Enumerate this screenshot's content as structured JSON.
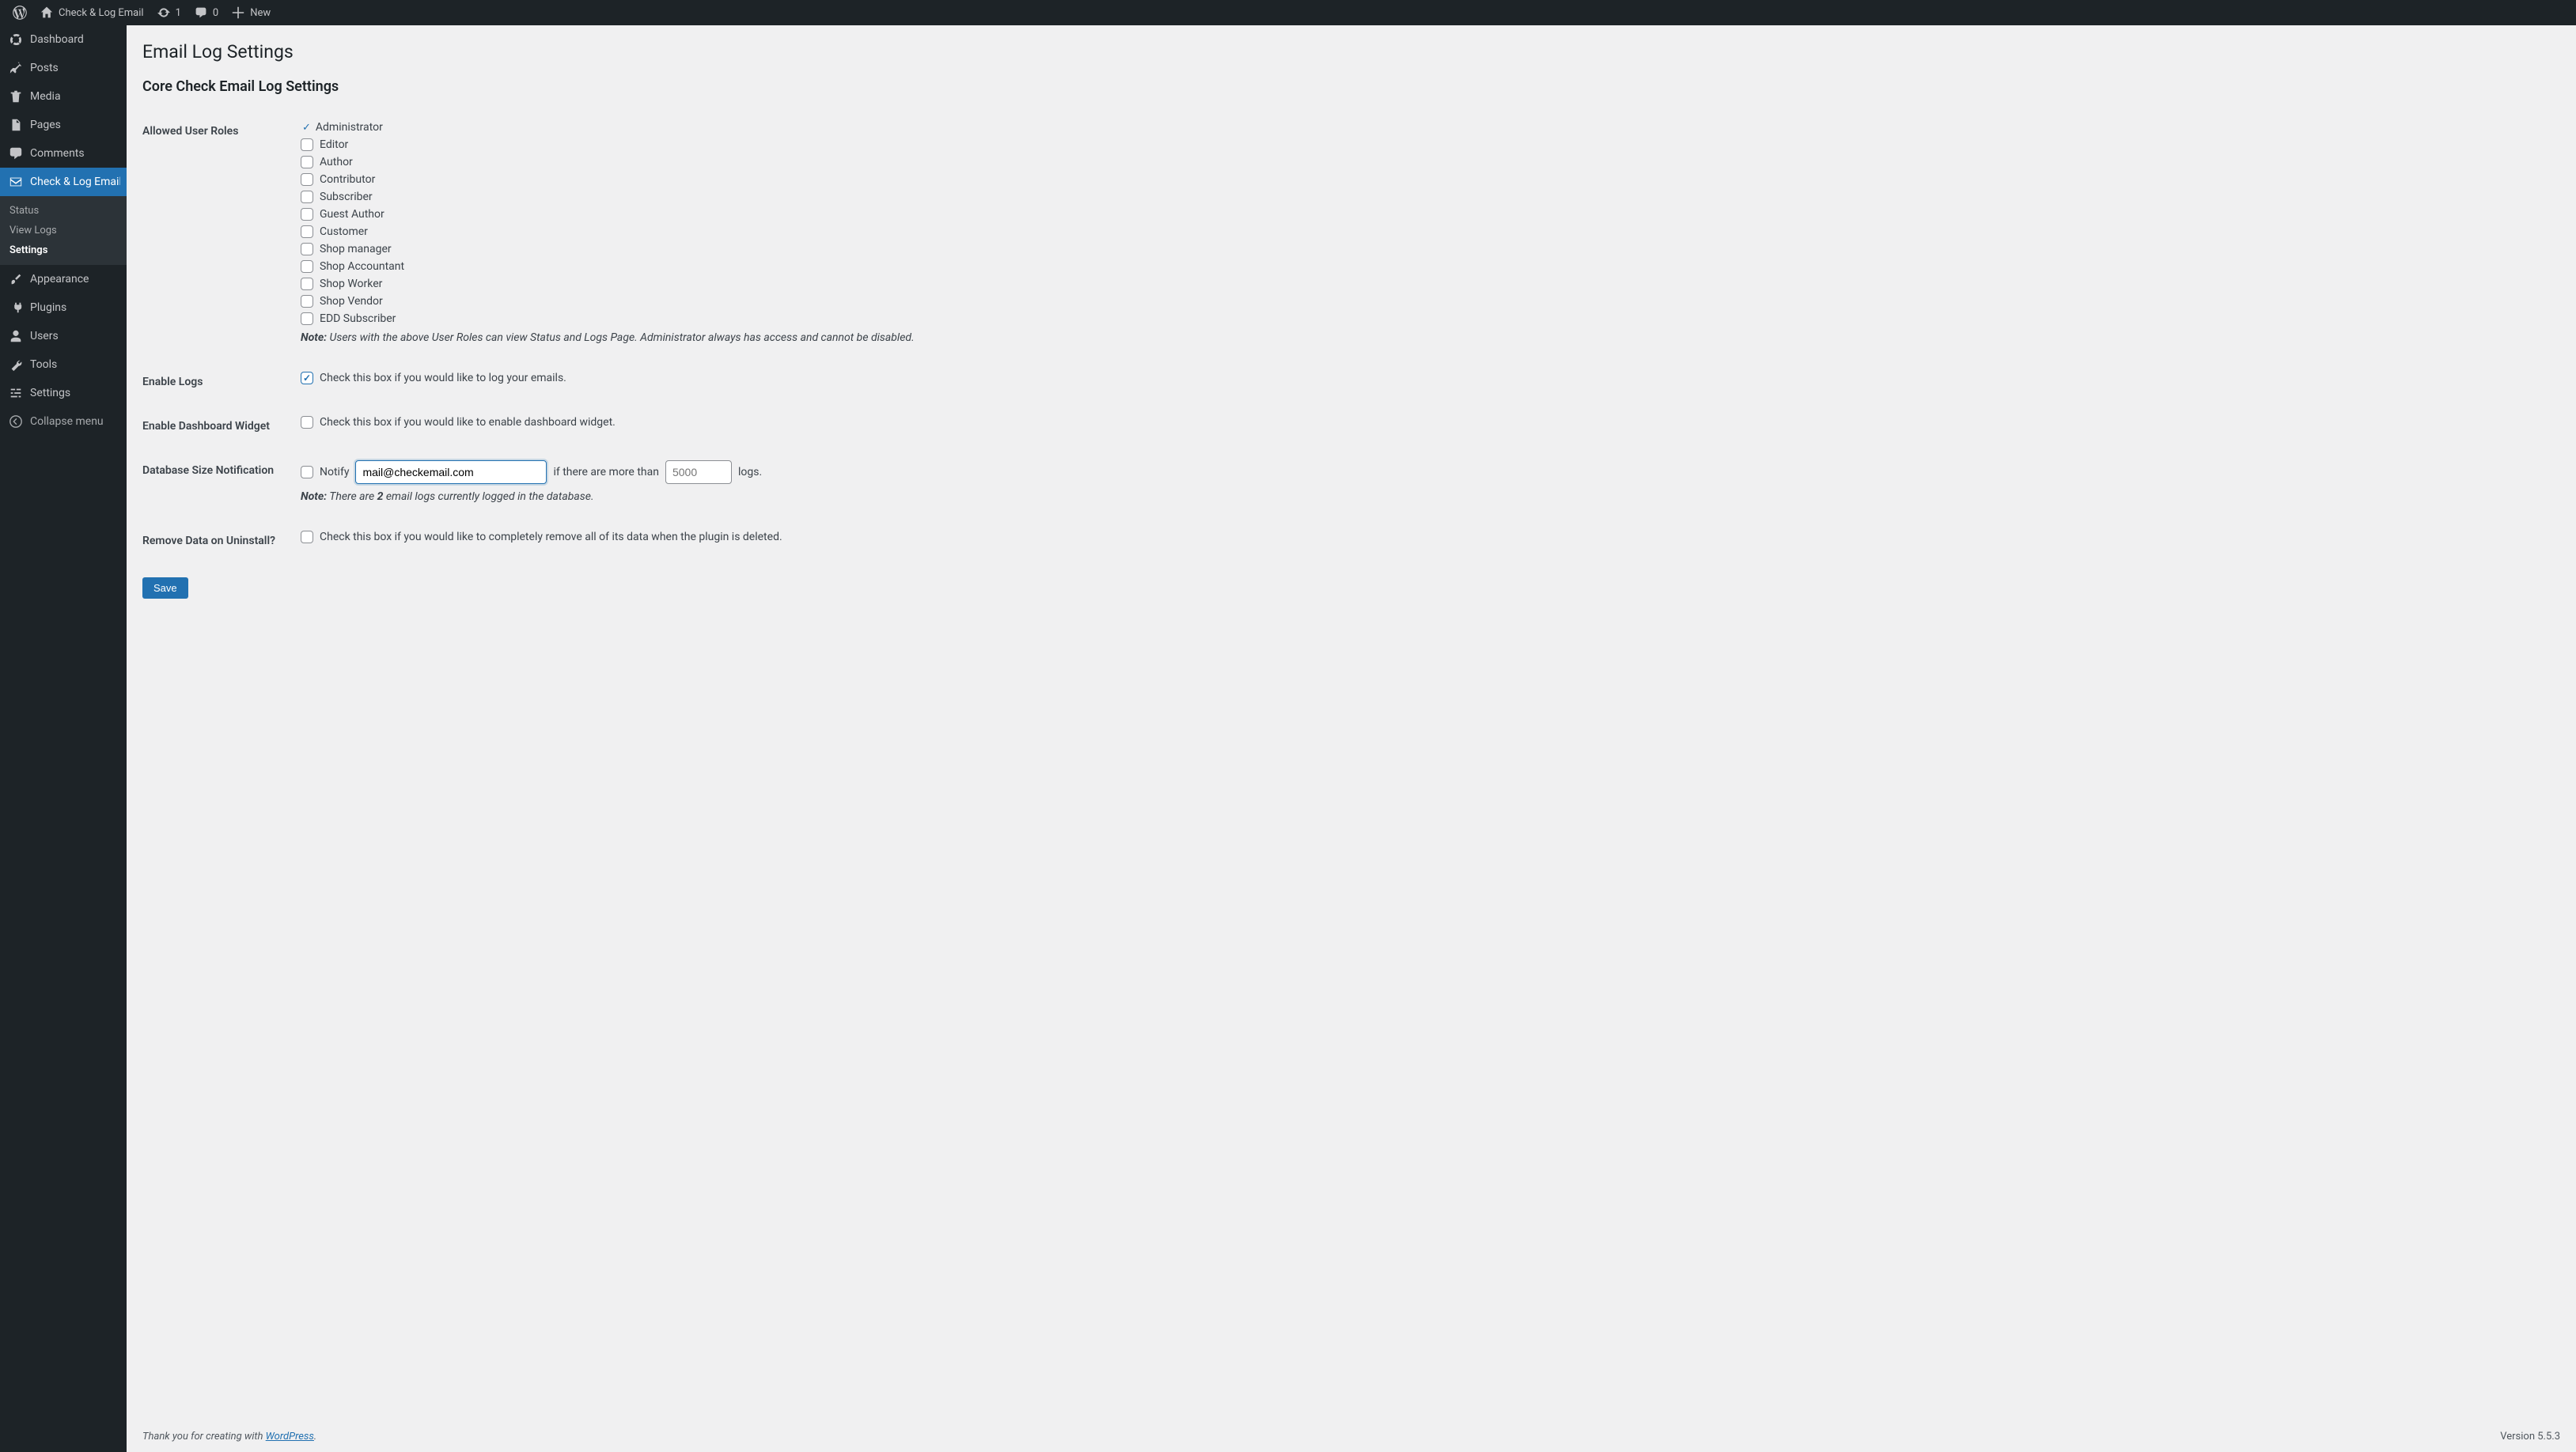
{
  "topbar": {
    "site_name": "Check & Log Email",
    "updates_count": "1",
    "comments_count": "0",
    "new_label": "New"
  },
  "sidebar": {
    "items": [
      {
        "label": "Dashboard"
      },
      {
        "label": "Posts"
      },
      {
        "label": "Media"
      },
      {
        "label": "Pages"
      },
      {
        "label": "Comments"
      },
      {
        "label": "Check & Log Email"
      },
      {
        "label": "Appearance"
      },
      {
        "label": "Plugins"
      },
      {
        "label": "Users"
      },
      {
        "label": "Tools"
      },
      {
        "label": "Settings"
      },
      {
        "label": "Collapse menu"
      }
    ],
    "submenu": [
      {
        "label": "Status"
      },
      {
        "label": "View Logs"
      },
      {
        "label": "Settings"
      }
    ]
  },
  "page": {
    "title": "Email Log Settings",
    "section_title": "Core Check Email Log Settings",
    "rows": {
      "allowed_roles": {
        "label": "Allowed User Roles",
        "admin_label": "Administrator",
        "roles": [
          "Editor",
          "Author",
          "Contributor",
          "Subscriber",
          "Guest Author",
          "Customer",
          "Shop manager",
          "Shop Accountant",
          "Shop Worker",
          "Shop Vendor",
          "EDD Subscriber"
        ],
        "note_label": "Note:",
        "note_text": " Users with the above User Roles can view Status and Logs Page. Administrator always has access and cannot be disabled."
      },
      "enable_logs": {
        "label": "Enable Logs",
        "desc": "Check this box if you would like to log your emails."
      },
      "enable_widget": {
        "label": "Enable Dashboard Widget",
        "desc": "Check this box if you would like to enable dashboard widget."
      },
      "db_notify": {
        "label": "Database Size Notification",
        "notify_word": "Notify",
        "email_value": "mail@checkemail.com",
        "mid_text": "if there are more than",
        "threshold_placeholder": "5000",
        "logs_word": "logs.",
        "note_label": "Note:",
        "note_pre": " There are ",
        "count": "2",
        "note_post": " email logs currently logged in the database."
      },
      "remove_data": {
        "label": "Remove Data on Uninstall?",
        "desc": "Check this box if you would like to completely remove all of its data when the plugin is deleted."
      }
    },
    "save_label": "Save"
  },
  "footer": {
    "thank_pre": "Thank you for creating with ",
    "link_text": "WordPress",
    "thank_post": ".",
    "version": "Version 5.5.3"
  }
}
